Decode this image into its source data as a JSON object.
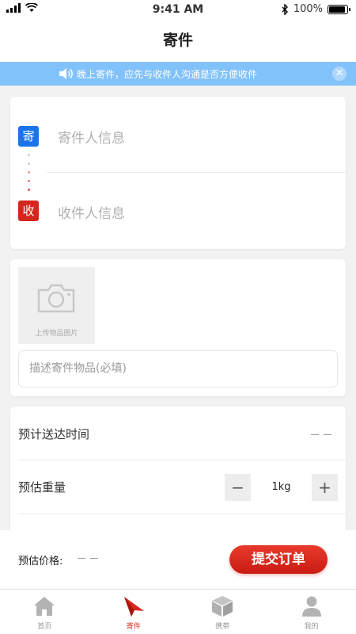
{
  "status_bar": {
    "time": "9:41 AM",
    "battery": "100%",
    "battery_level": 1.0
  },
  "nav": {
    "title": "寄件"
  },
  "notice": {
    "text": "晚上寄件，应先与收件人沟通是否方便收件",
    "close_icon": "close-icon"
  },
  "address": {
    "sender": {
      "tag": "寄",
      "placeholder": "寄件人信息",
      "color": "#1a73e8"
    },
    "receiver": {
      "tag": "收",
      "placeholder": "收件人信息",
      "color": "#d6261c"
    }
  },
  "upload": {
    "caption": "上传物品图片",
    "description_placeholder": "描述寄件物品(必填)"
  },
  "info": {
    "delivery_time": {
      "label": "预计送达时间",
      "value": "－－"
    },
    "weight": {
      "label": "预估重量",
      "minus": "−",
      "value": "1kg",
      "plus": "+"
    }
  },
  "price_bar": {
    "label": "预估价格:",
    "value": "－－",
    "submit_label": "提交订单"
  },
  "tabs": [
    {
      "label": "首页",
      "icon": "home-icon",
      "active": false
    },
    {
      "label": "寄件",
      "icon": "send-icon",
      "active": true
    },
    {
      "label": "携带",
      "icon": "box-icon",
      "active": false
    },
    {
      "label": "我的",
      "icon": "user-icon",
      "active": false
    }
  ],
  "colors": {
    "accent_red": "#d9251c",
    "notice_blue": "#82c2fb",
    "sender_blue": "#1a73e8"
  }
}
